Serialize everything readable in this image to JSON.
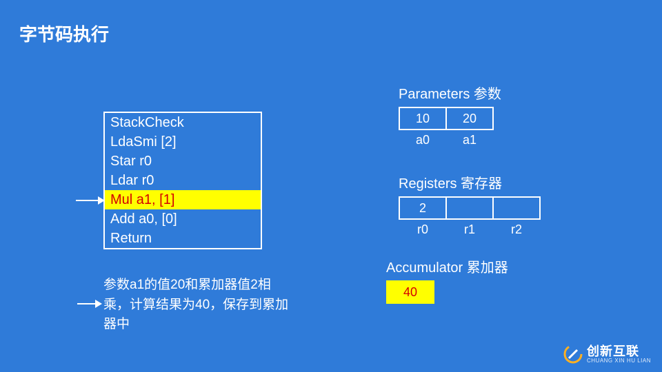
{
  "title": "字节码执行",
  "code": {
    "lines": [
      {
        "text": "StackCheck",
        "hl": false
      },
      {
        "text": "LdaSmi [2]",
        "hl": false
      },
      {
        "text": "Star r0",
        "hl": false
      },
      {
        "text": "Ldar r0",
        "hl": false
      },
      {
        "text": "Mul a1, [1]",
        "hl": true
      },
      {
        "text": "Add a0, [0]",
        "hl": false
      },
      {
        "text": "Return",
        "hl": false
      }
    ]
  },
  "explain": "参数a1的值20和累加器值2相乘，计算结果为40，保存到累加器中",
  "params": {
    "label": "Parameters 参数",
    "cells": [
      "10",
      "20"
    ],
    "subs": [
      "a0",
      "a1"
    ]
  },
  "regs": {
    "label": "Registers 寄存器",
    "cells": [
      "2",
      "",
      ""
    ],
    "subs": [
      "r0",
      "r1",
      "r2"
    ]
  },
  "accum": {
    "label": "Accumulator 累加器",
    "value": "40"
  },
  "logo": {
    "main": "创新互联",
    "sub": "CHUANG XIN HU LIAN"
  }
}
